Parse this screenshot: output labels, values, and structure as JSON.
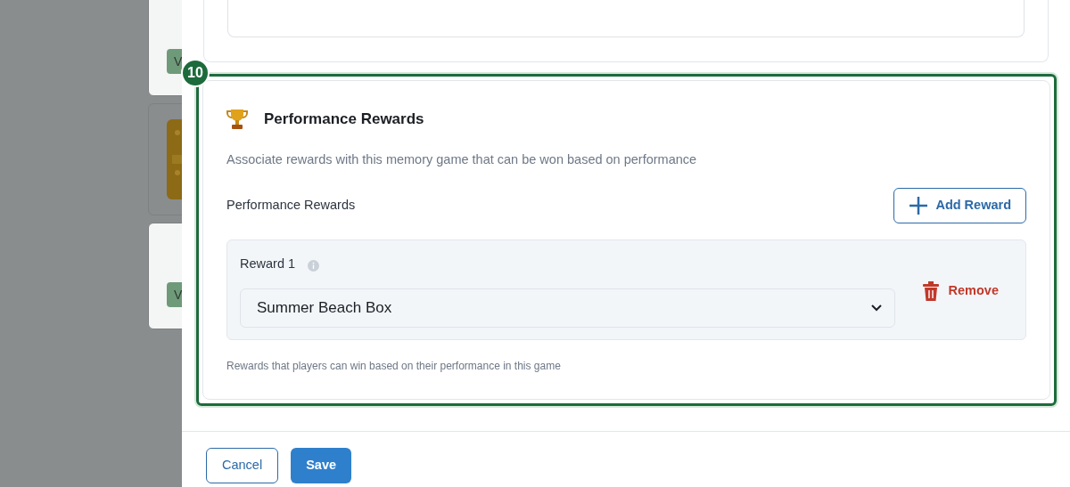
{
  "background_cards": [
    {
      "kind": "badge",
      "badge": "V"
    },
    {
      "kind": "picture"
    },
    {
      "kind": "badge",
      "badge": "V"
    }
  ],
  "step_badge": "10",
  "section": {
    "title": "Performance Rewards",
    "description": "Associate rewards with this memory game that can be won based on performance",
    "list_label": "Performance Rewards",
    "add_button": "Add Reward",
    "rewards": [
      {
        "label": "Reward 1",
        "value": "Summer Beach Box",
        "remove": "Remove"
      }
    ],
    "help": "Rewards that players can win based on their performance in this game"
  },
  "footer": {
    "cancel": "Cancel",
    "save": "Save"
  }
}
